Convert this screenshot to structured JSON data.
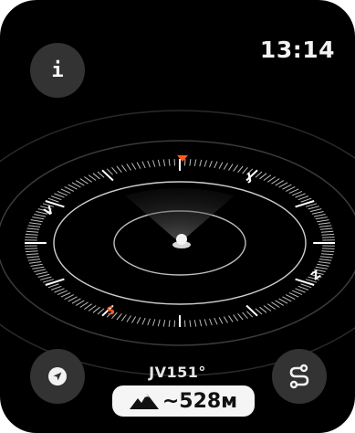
{
  "status": {
    "time": "13:14"
  },
  "buttons": {
    "info_label": "i",
    "location_icon": "location-arrow-icon",
    "route_icon": "route-icon"
  },
  "compass": {
    "north_label": "J",
    "east_label": "Z",
    "south_label": "S",
    "west_label": "V",
    "heading_text": "JV151°",
    "north_marker_color": "#ff5a1f",
    "south_label_color": "#ff5a1f"
  },
  "altitude": {
    "icon": "mountain-icon",
    "text": "~528м"
  }
}
